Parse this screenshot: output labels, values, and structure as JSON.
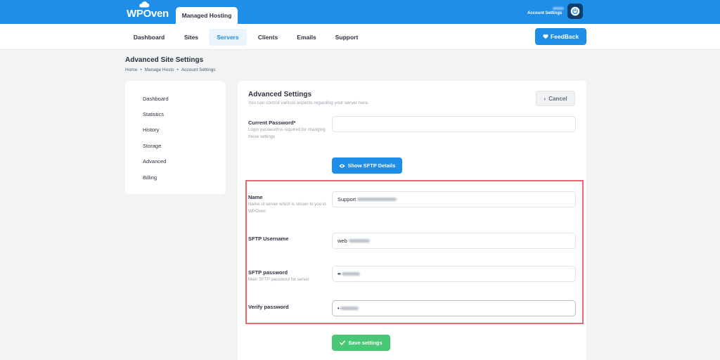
{
  "header": {
    "logo": "WPOven",
    "product_tab": "Managed Hosting",
    "account_label": "Account Settings"
  },
  "nav": {
    "items": [
      "Dashboard",
      "Sites",
      "Servers",
      "Clients",
      "Emails",
      "Support"
    ],
    "active": "Servers",
    "feedback": "FeedBack"
  },
  "page": {
    "title": "Advanced Site Settings",
    "breadcrumb": [
      "Home",
      "Manage Hosts",
      "Account Settings"
    ]
  },
  "sidebar": {
    "items": [
      "Dashboard",
      "Statistics",
      "History",
      "Storage",
      "Advanced",
      "Billing"
    ]
  },
  "card": {
    "title": "Advanced Settings",
    "subtitle": "You can control various aspects regarding your server here.",
    "cancel": "Cancel",
    "current_password": {
      "label": "Current Password*",
      "help": "Login password is required for changing these settings",
      "value": ""
    },
    "sftp_button": "Show SFTP Details",
    "name": {
      "label": "Name",
      "help": "Name of server which is shown to you in WPOven",
      "value": "Support"
    },
    "sftp_username": {
      "label": "SFTP Username",
      "value": "web"
    },
    "sftp_password": {
      "label": "SFTP password",
      "help": "Main SFTP password for server",
      "value": "••"
    },
    "verify_password": {
      "label": "Verify password",
      "value": "•"
    },
    "save": "Save settings"
  },
  "colors": {
    "brand": "#1e8ee8",
    "success": "#49c776",
    "highlight": "#e8676a"
  }
}
